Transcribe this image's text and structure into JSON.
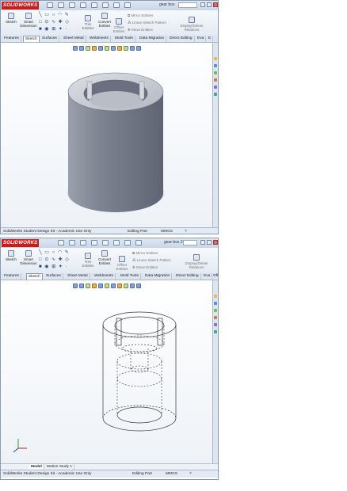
{
  "app": {
    "logo": "SOLIDWORKS"
  },
  "top": {
    "document_title": "gear box",
    "ribbon": {
      "sketch": "Sketch",
      "smart_dimension": "Smart Dimension",
      "trim_entities": "Trim Entities",
      "convert_entities": "Convert Entities",
      "offset_entities": "Offset Entities",
      "mirror_entities": "Mirror Entities",
      "linear_sketch_pattern": "Linear Sketch Pattern",
      "move_entities": "Move Entities",
      "display_delete_relations": "Display/Delete Relations"
    },
    "tabs": [
      "Features",
      "Sketch",
      "Surfaces",
      "Sheet Metal",
      "Weldments",
      "Mold Tools",
      "Data Migration",
      "Direct Editing",
      "Eva",
      "E"
    ],
    "active_tab": "Sketch",
    "status": {
      "left": "SolidWorks Student Design Kit - Academic Use Only",
      "mode": "Editing Part",
      "units": "MMGS"
    }
  },
  "bottom": {
    "document_title": "gear box 2",
    "ribbon": {
      "sketch": "Sketch",
      "smart_dimension": "Smart Dimension",
      "trim_entities": "Trim Entities",
      "convert_entities": "Convert Entities",
      "offset_entities": "Offset Entities",
      "mirror_entities": "Mirror Entities",
      "linear_sketch_pattern": "Linear Sketch Pattern",
      "move_entities": "Move Entities",
      "display_delete_relations": "Display/Delete Relations"
    },
    "tabs": [
      "Features",
      "Sketch",
      "Surfaces",
      "Sheet Metal",
      "Weldments",
      "Mold Tools",
      "Data Migration",
      "Direct Editing",
      "Eva",
      "Off"
    ],
    "active_tab": "Sketch",
    "model_tabs": [
      "Model",
      "Motion Study 1"
    ],
    "active_model_tab": "Model",
    "status": {
      "left": "SolidWorks Student Design Kit - Academic Use Only",
      "mode": "Editing Part",
      "units": "MMGS"
    }
  },
  "colors": {
    "solidworks_red": "#c41e1e",
    "cylinder_body": "#7e8593",
    "cylinder_top": "#c9ccd4",
    "wire": "#333333"
  }
}
